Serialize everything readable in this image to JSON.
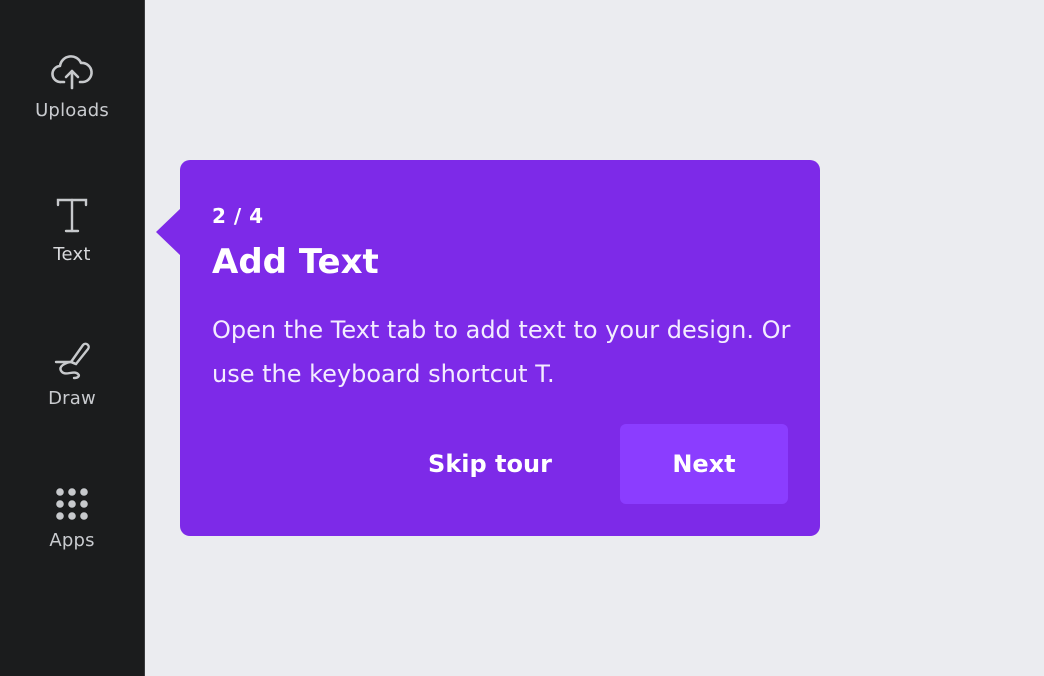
{
  "sidebar": {
    "items": [
      {
        "label": "Uploads",
        "icon": "cloud-upload-icon"
      },
      {
        "label": "Text",
        "icon": "text-icon"
      },
      {
        "label": "Draw",
        "icon": "draw-icon"
      },
      {
        "label": "Apps",
        "icon": "apps-grid-icon"
      }
    ]
  },
  "tour": {
    "step": "2 / 4",
    "title": "Add Text",
    "description": "Open the Text tab to add text to your design. Or use the keyboard shortcut T.",
    "skip_label": "Skip tour",
    "next_label": "Next"
  },
  "colors": {
    "sidebar_bg": "#1b1c1d",
    "canvas_bg": "#ebecf0",
    "tooltip_bg": "#7d2ae8",
    "next_button_bg": "#8b3dff"
  }
}
